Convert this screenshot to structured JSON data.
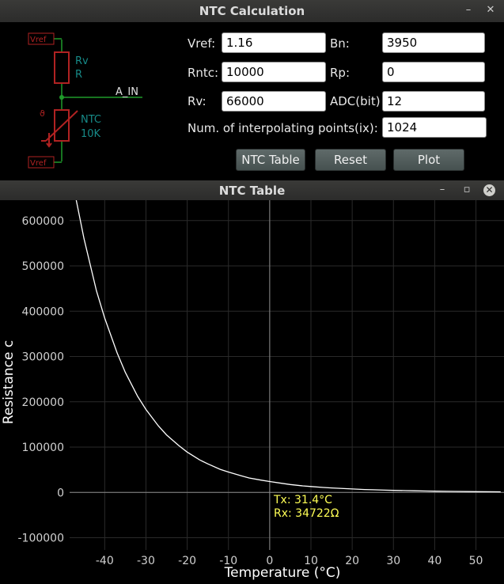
{
  "main_window": {
    "title": "NTC Calculation",
    "minimize_glyph": "–",
    "close_glyph": "✕"
  },
  "schematic": {
    "vref_top": "Vref",
    "rv_name": "Rv",
    "rv_value": "R",
    "node_label": "A_IN",
    "ntc_name": "NTC",
    "ntc_value": "10K",
    "theta_symbol": "ϑ",
    "vref_bottom": "Vref"
  },
  "form": {
    "vref": {
      "label": "Vref:",
      "value": "1.16"
    },
    "bn": {
      "label": "Bn:",
      "value": "3950"
    },
    "rntc": {
      "label": "Rntc:",
      "value": "10000"
    },
    "rp": {
      "label": "Rp:",
      "value": "0"
    },
    "rv": {
      "label": "Rv:",
      "value": "66000"
    },
    "adc": {
      "label": "ADC(bit)",
      "value": "12"
    },
    "ix": {
      "label": "Num. of interpolating points(ix):",
      "value": "1024"
    }
  },
  "buttons": {
    "ntc_table": "NTC Table",
    "reset": "Reset",
    "plot": "Plot"
  },
  "plot_window": {
    "title": "NTC Table",
    "minimize_glyph": "–",
    "restore_glyph": "▫",
    "close_glyph": "✕"
  },
  "chart_data": {
    "type": "line",
    "xlabel": "Temperature (°C)",
    "ylabel": "Resistance c",
    "xlim": [
      -48.5,
      56.8
    ],
    "ylim": [
      -127000,
      645000
    ],
    "x_ticks": [
      -40,
      -30,
      -20,
      -10,
      0,
      10,
      20,
      30,
      40,
      50
    ],
    "y_ticks": [
      -100000,
      0,
      100000,
      200000,
      300000,
      400000,
      500000,
      600000
    ],
    "x_tick_labels": [
      "-40",
      "-30",
      "-20",
      "-10",
      "0",
      "10",
      "20",
      "30",
      "40",
      "50"
    ],
    "y_tick_labels": [
      "-100000",
      "0",
      "100000",
      "200000",
      "300000",
      "400000",
      "500000",
      "600000"
    ],
    "grid": true,
    "series": [
      {
        "x": [
          -47,
          -45,
          -42,
          -40,
          -37,
          -35,
          -32,
          -30,
          -27,
          -25,
          -22,
          -20,
          -17,
          -15,
          -12,
          -10,
          -7,
          -5,
          -2,
          0,
          3,
          5,
          8,
          10,
          13,
          15,
          18,
          20,
          23,
          25,
          28,
          30,
          33,
          35,
          38,
          40,
          43,
          45,
          48,
          50,
          53,
          56
        ],
        "y": [
          650000,
          560000,
          445000,
          385000,
          308000,
          265000,
          212000,
          183000,
          147000,
          127000,
          103000,
          89000,
          72000,
          63000,
          51000,
          45000,
          37000,
          32000,
          27000,
          24000,
          20000,
          17500,
          14500,
          13000,
          11000,
          10000,
          8500,
          7700,
          6500,
          6000,
          5000,
          4600,
          4000,
          3600,
          3100,
          2800,
          2400,
          2200,
          1900,
          1750,
          1500,
          1300
        ],
        "color": "#ffffff"
      }
    ],
    "crosshair": {
      "x": 0,
      "y": 0
    },
    "readout": {
      "tx": "Tx: 31.4°C",
      "rx": "Rx: 34722Ω",
      "color": "#ffff55"
    }
  }
}
